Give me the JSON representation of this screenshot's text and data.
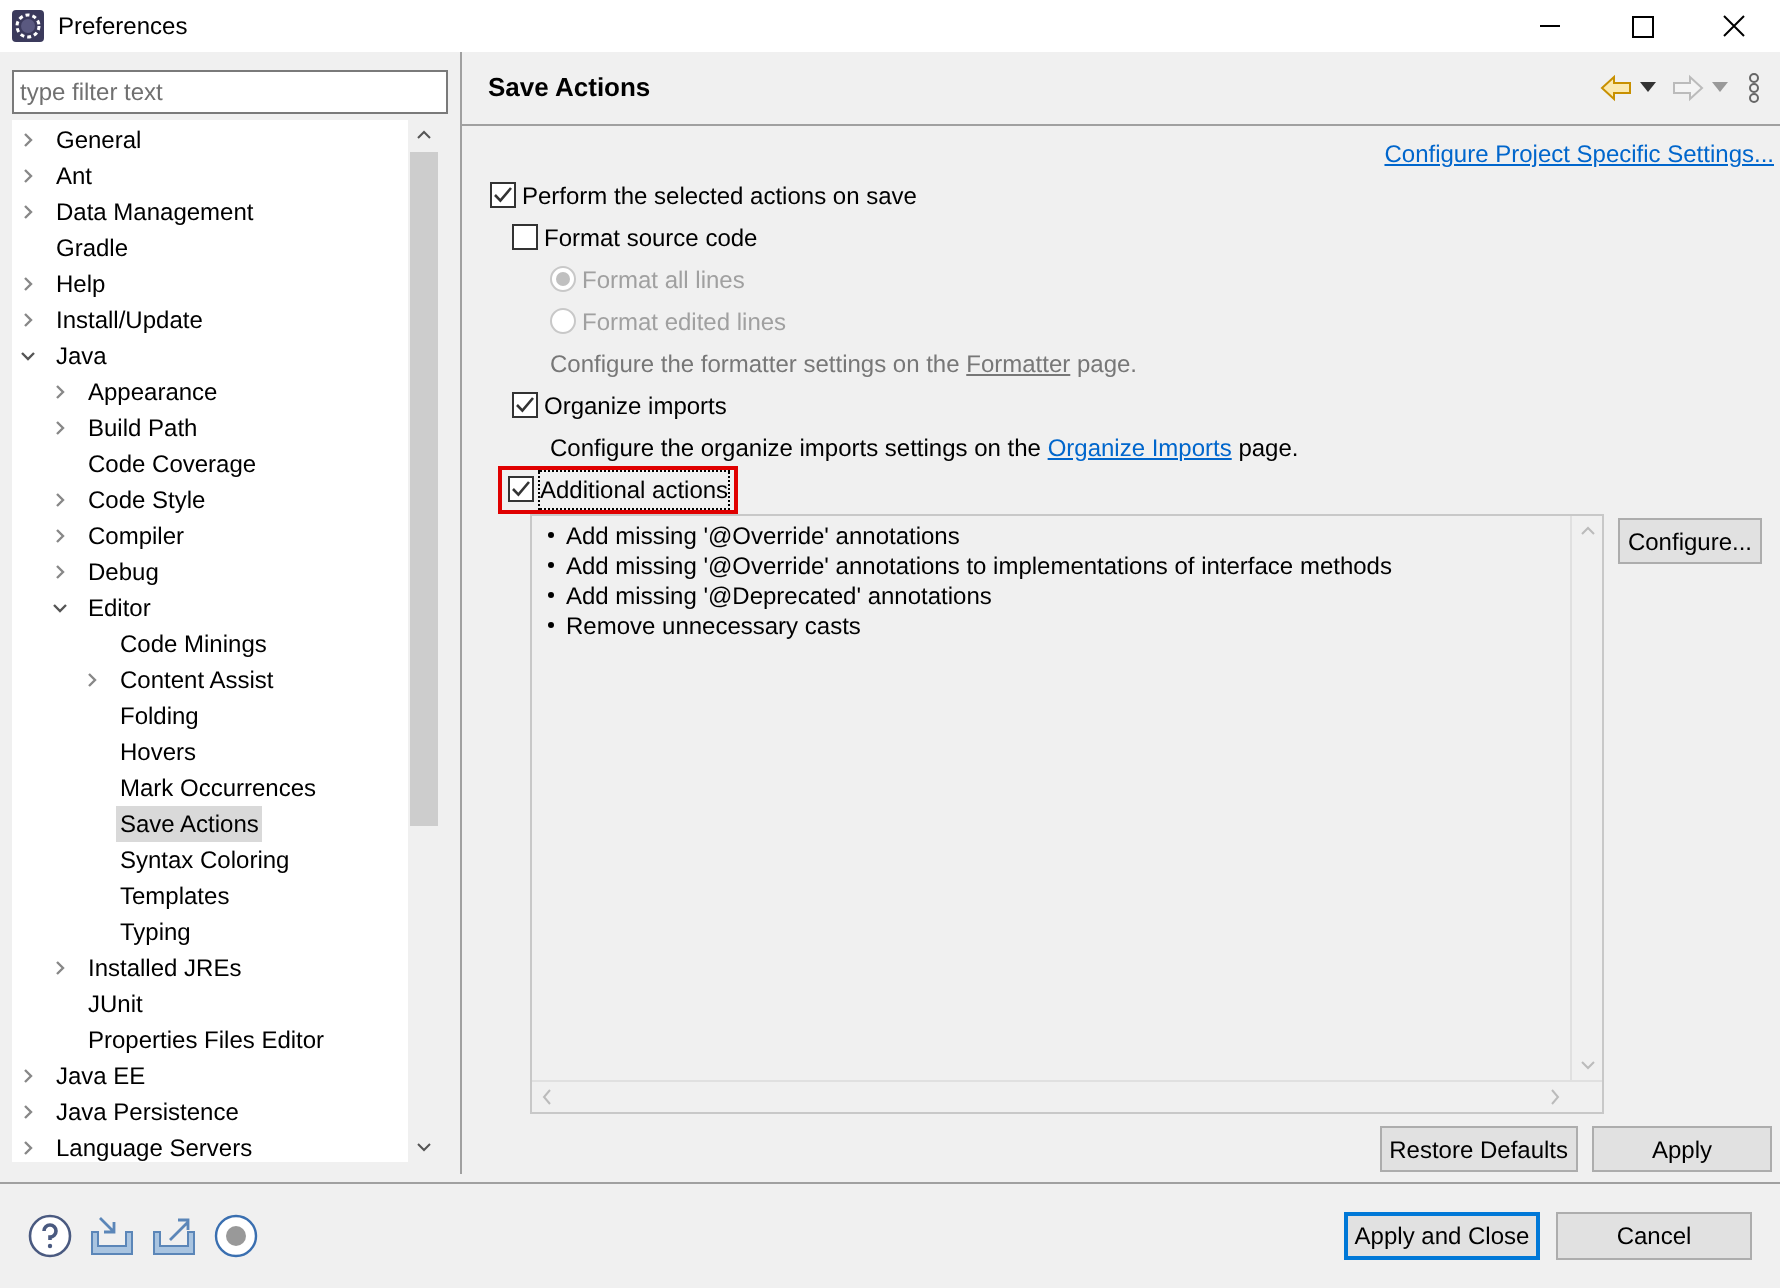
{
  "window": {
    "title": "Preferences"
  },
  "filter": {
    "placeholder": "type filter text"
  },
  "tree": [
    {
      "label": "General",
      "kind": "group",
      "expanded": false,
      "selected": false
    },
    {
      "label": "Ant",
      "kind": "group",
      "expanded": false,
      "selected": false
    },
    {
      "label": "Data Management",
      "kind": "group",
      "expanded": false,
      "selected": false
    },
    {
      "label": "Gradle",
      "kind": "leaf",
      "selected": false
    },
    {
      "label": "Help",
      "kind": "group",
      "expanded": false,
      "selected": false
    },
    {
      "label": "Install/Update",
      "kind": "group",
      "expanded": false,
      "selected": false
    },
    {
      "label": "Java",
      "kind": "group",
      "expanded": true,
      "selected": false,
      "children": [
        {
          "label": "Appearance",
          "kind": "group",
          "expanded": false,
          "selected": false
        },
        {
          "label": "Build Path",
          "kind": "group",
          "expanded": false,
          "selected": false
        },
        {
          "label": "Code Coverage",
          "kind": "leaf",
          "selected": false
        },
        {
          "label": "Code Style",
          "kind": "group",
          "expanded": false,
          "selected": false
        },
        {
          "label": "Compiler",
          "kind": "group",
          "expanded": false,
          "selected": false
        },
        {
          "label": "Debug",
          "kind": "group",
          "expanded": false,
          "selected": false
        },
        {
          "label": "Editor",
          "kind": "group",
          "expanded": true,
          "selected": false,
          "children": [
            {
              "label": "Code Minings",
              "kind": "leaf",
              "selected": false
            },
            {
              "label": "Content Assist",
              "kind": "group",
              "expanded": false,
              "selected": false
            },
            {
              "label": "Folding",
              "kind": "leaf",
              "selected": false
            },
            {
              "label": "Hovers",
              "kind": "leaf",
              "selected": false
            },
            {
              "label": "Mark Occurrences",
              "kind": "leaf",
              "selected": false
            },
            {
              "label": "Save Actions",
              "kind": "leaf",
              "selected": true
            },
            {
              "label": "Syntax Coloring",
              "kind": "leaf",
              "selected": false
            },
            {
              "label": "Templates",
              "kind": "leaf",
              "selected": false
            },
            {
              "label": "Typing",
              "kind": "leaf",
              "selected": false
            }
          ]
        },
        {
          "label": "Installed JREs",
          "kind": "group",
          "expanded": false,
          "selected": false
        },
        {
          "label": "JUnit",
          "kind": "leaf",
          "selected": false
        },
        {
          "label": "Properties Files Editor",
          "kind": "leaf",
          "selected": false
        }
      ]
    },
    {
      "label": "Java EE",
      "kind": "group",
      "expanded": false,
      "selected": false
    },
    {
      "label": "Java Persistence",
      "kind": "group",
      "expanded": false,
      "selected": false
    },
    {
      "label": "Language Servers",
      "kind": "group",
      "expanded": false,
      "selected": false
    }
  ],
  "page": {
    "title": "Save Actions",
    "project_link": "Configure Project Specific Settings...",
    "options": [
      {
        "kind": "checkbox",
        "label": "Perform the selected actions on save",
        "checked": true,
        "disabled": false,
        "highlighted": false,
        "children": [
          {
            "kind": "checkbox",
            "label": "Format source code",
            "checked": false,
            "disabled": false,
            "highlighted": false,
            "children": [
              {
                "kind": "radio",
                "label": "Format all lines",
                "checked": true,
                "disabled": true,
                "highlighted": false
              },
              {
                "kind": "radio",
                "label": "Format edited lines",
                "checked": false,
                "disabled": true,
                "highlighted": false
              },
              {
                "kind": "note",
                "before": "Configure the formatter settings on the ",
                "link": "Formatter",
                "after": " page.",
                "disabled": true
              }
            ]
          },
          {
            "kind": "checkbox",
            "label": "Organize imports",
            "checked": true,
            "disabled": false,
            "highlighted": false,
            "children": [
              {
                "kind": "note",
                "before": "Configure the organize imports settings on the ",
                "link": "Organize Imports",
                "after": " page.",
                "disabled": false
              }
            ]
          },
          {
            "kind": "checkbox",
            "label": "Additional actions",
            "checked": true,
            "disabled": false,
            "highlighted": true
          }
        ]
      }
    ],
    "actions_list": [
      "Add missing '@Override' annotations",
      "Add missing '@Override' annotations to implementations of interface methods",
      "Add missing '@Deprecated' annotations",
      "Remove unnecessary casts"
    ],
    "configure_button": "Configure...",
    "buttons": [
      "Restore Defaults",
      "Apply"
    ]
  },
  "footer_buttons": [
    {
      "label": "Apply and Close",
      "selected": true
    },
    {
      "label": "Cancel",
      "selected": false
    }
  ]
}
